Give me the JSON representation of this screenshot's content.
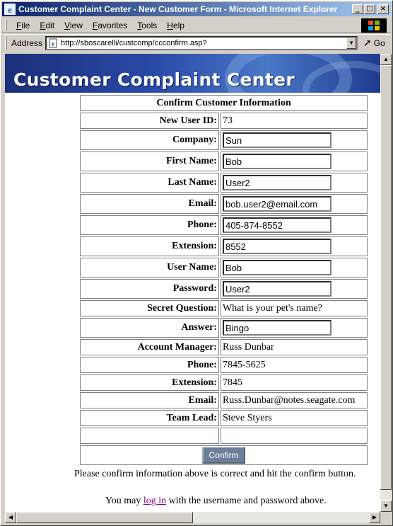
{
  "window": {
    "title": "Customer Complaint Center - New Customer Form - Microsoft Internet Explorer",
    "minimize": "_",
    "maximize": "□",
    "close": "×"
  },
  "menu": [
    "File",
    "Edit",
    "View",
    "Favorites",
    "Tools",
    "Help"
  ],
  "address": {
    "label": "Address",
    "url": "http://sboscarelli/custcomp/ccconfirm.asp?",
    "go_label": "Go"
  },
  "page": {
    "banner_title": "Customer Complaint Center",
    "form_header": "Confirm Customer Information",
    "fields": {
      "new_user_id": {
        "label": "New User ID:",
        "value": "73"
      },
      "company": {
        "label": "Company:",
        "value": "Sun"
      },
      "first_name": {
        "label": "First Name:",
        "value": "Bob"
      },
      "last_name": {
        "label": "Last Name:",
        "value": "User2"
      },
      "email": {
        "label": "Email:",
        "value": "bob.user2@email.com"
      },
      "phone": {
        "label": "Phone:",
        "value": "405-874-8552"
      },
      "extension": {
        "label": "Extension:",
        "value": "8552"
      },
      "user_name": {
        "label": "User Name:",
        "value": "Bob"
      },
      "password": {
        "label": "Password:",
        "value": "User2"
      },
      "secret_question": {
        "label": "Secret Question:",
        "value": "What is your pet's name?"
      },
      "answer": {
        "label": "Answer:",
        "value": "Bingo"
      },
      "account_manager": {
        "label": "Account Manager:",
        "value": "Russ Dunbar"
      },
      "am_phone": {
        "label": "Phone:",
        "value": "7845-5625"
      },
      "am_extension": {
        "label": "Extension:",
        "value": "7845"
      },
      "am_email": {
        "label": "Email:",
        "value": "Russ.Dunbar@notes.seagate.com"
      },
      "team_lead": {
        "label": "Team Lead:",
        "value": "Steve Styers"
      }
    },
    "confirm_button": "Confirm",
    "note": "Please confirm information above is correct and hit the confirm button.",
    "login_prefix": "You may ",
    "login_link": "log in",
    "login_suffix": " with the username and password above."
  }
}
